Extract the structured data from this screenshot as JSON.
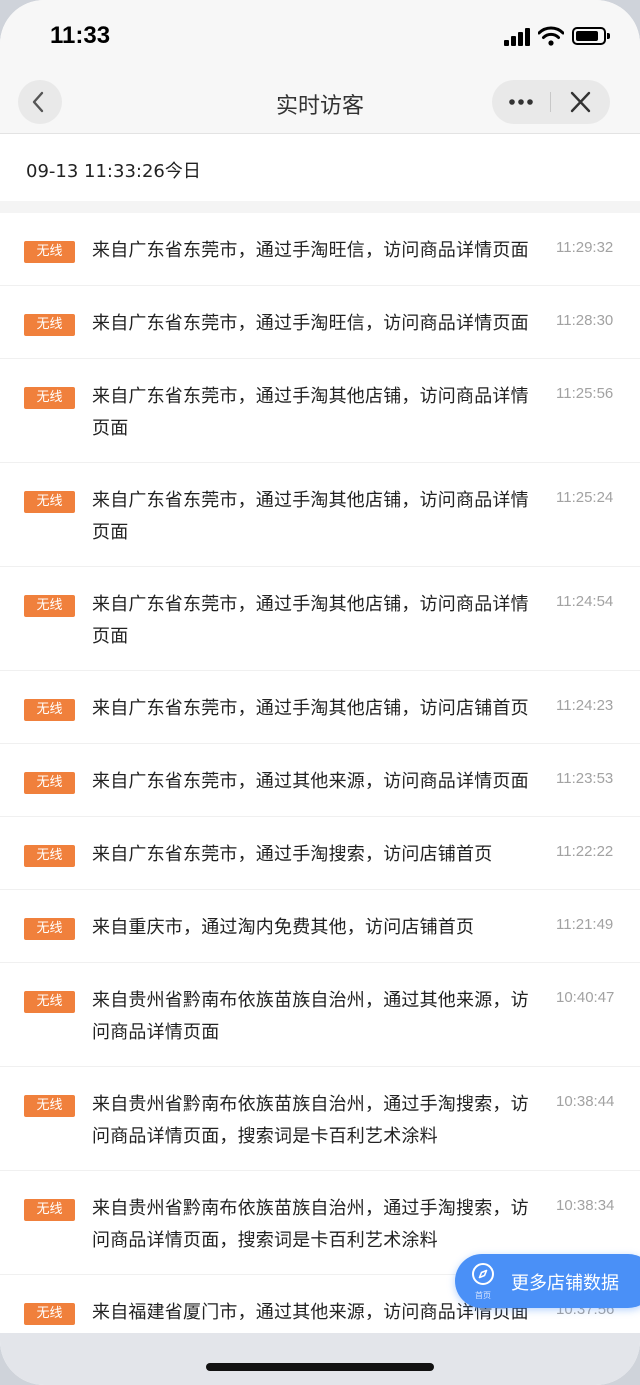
{
  "status_bar": {
    "time": "11:33"
  },
  "nav": {
    "title": "实时访客"
  },
  "header": {
    "datetime": "09-13 11:33:26今日"
  },
  "visits": [
    {
      "badge": "无线",
      "text": "来自广东省东莞市，通过手淘旺信，访问商品详情页面",
      "time": "11:29:32"
    },
    {
      "badge": "无线",
      "text": "来自广东省东莞市，通过手淘旺信，访问商品详情页面",
      "time": "11:28:30"
    },
    {
      "badge": "无线",
      "text": "来自广东省东莞市，通过手淘其他店铺，访问商品详情页面",
      "time": "11:25:56"
    },
    {
      "badge": "无线",
      "text": "来自广东省东莞市，通过手淘其他店铺，访问商品详情页面",
      "time": "11:25:24"
    },
    {
      "badge": "无线",
      "text": "来自广东省东莞市，通过手淘其他店铺，访问商品详情页面",
      "time": "11:24:54"
    },
    {
      "badge": "无线",
      "text": "来自广东省东莞市，通过手淘其他店铺，访问店铺首页",
      "time": "11:24:23"
    },
    {
      "badge": "无线",
      "text": "来自广东省东莞市，通过其他来源，访问商品详情页面",
      "time": "11:23:53"
    },
    {
      "badge": "无线",
      "text": "来自广东省东莞市，通过手淘搜索，访问店铺首页",
      "time": "11:22:22"
    },
    {
      "badge": "无线",
      "text": "来自重庆市，通过淘内免费其他，访问店铺首页",
      "time": "11:21:49"
    },
    {
      "badge": "无线",
      "text": "来自贵州省黔南布依族苗族自治州，通过其他来源，访问商品详情页面",
      "time": "10:40:47"
    },
    {
      "badge": "无线",
      "text": "来自贵州省黔南布依族苗族自治州，通过手淘搜索，访问商品详情页面，搜索词是卡百利艺术涂料",
      "time": "10:38:44"
    },
    {
      "badge": "无线",
      "text": "来自贵州省黔南布依族苗族自治州，通过手淘搜索，访问商品详情页面，搜索词是卡百利艺术涂料",
      "time": "10:38:34"
    },
    {
      "badge": "无线",
      "text": "来自福建省厦门市，通过其他来源，访问商品详情页面",
      "time": "10:37:56"
    }
  ],
  "float_button": {
    "icon_label": "首页",
    "label": "更多店铺数据",
    "icon": "compass-icon"
  },
  "colors": {
    "badge": "#f0803c",
    "float_button": "#4a90f7"
  }
}
